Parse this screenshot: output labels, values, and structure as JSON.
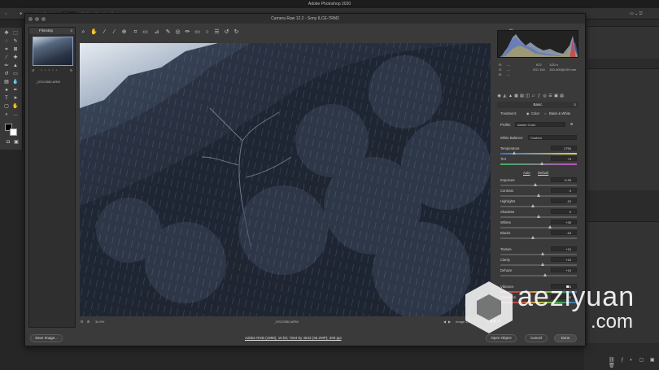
{
  "app": {
    "menubar_title": "Adobe Photoshop 2020"
  },
  "options_bar": {
    "auto_select_label": "Auto-Select:",
    "auto_select_value": "Group",
    "transform_label": "Show Transform Controls"
  },
  "dialog": {
    "title": "Camera Raw 12.2  -  Sony ILCE-7RM2",
    "filmstrip_label": "Filmstrip",
    "thumb_rating": "* * * * *",
    "thumb_name": "_DSC0380.ARW",
    "zoom": "34.9%",
    "filename": "_DSC0380.ARW",
    "image_count": "Image 1/1",
    "workflow_link": "Adobe RGB (1998); 16 bit; 7264 by 4843 (35.2MP); 300 ppi",
    "buttons": {
      "save": "Save Image...",
      "open": "Open Object",
      "cancel": "Cancel",
      "done": "Done"
    }
  },
  "camera_info": {
    "r": "R:",
    "g": "G:",
    "b": "B:",
    "dash": "---",
    "aperture": "f/22",
    "shutter": "1/20 s",
    "iso": "ISO 100",
    "lens": "100-400@100 mm"
  },
  "basic": {
    "header": "Basic",
    "treatment_label": "Treatment:",
    "color_option": "Color",
    "bw_option": "Black & White",
    "profile_label": "Profile:",
    "profile_value": "Adobe Color",
    "wb_label": "White Balance:",
    "wb_value": "Custom",
    "auto": "Auto",
    "default": "Default",
    "sliders": [
      {
        "label": "Temperature",
        "value": "2750",
        "pos": 0.18
      },
      {
        "label": "Tint",
        "value": "+9",
        "pos": 0.54
      },
      {
        "label": "Exposure",
        "value": "-0.35",
        "pos": 0.46
      },
      {
        "label": "Contrast",
        "value": "0",
        "pos": 0.5
      },
      {
        "label": "Highlights",
        "value": "-15",
        "pos": 0.43
      },
      {
        "label": "Shadows",
        "value": "0",
        "pos": 0.5
      },
      {
        "label": "Whites",
        "value": "+30",
        "pos": 0.65
      },
      {
        "label": "Blacks",
        "value": "-15",
        "pos": 0.43
      },
      {
        "label": "Texture",
        "value": "+10",
        "pos": 0.55
      },
      {
        "label": "Clarity",
        "value": "+10",
        "pos": 0.55
      },
      {
        "label": "Dehaze",
        "value": "+15",
        "pos": 0.58
      },
      {
        "label": "Vibrance",
        "value": "-33",
        "pos": 0.34
      },
      {
        "label": "Saturation",
        "value": "-50",
        "pos": 0.25
      }
    ]
  },
  "watermark": {
    "text": "aeziyuan",
    "sub": ".com"
  }
}
